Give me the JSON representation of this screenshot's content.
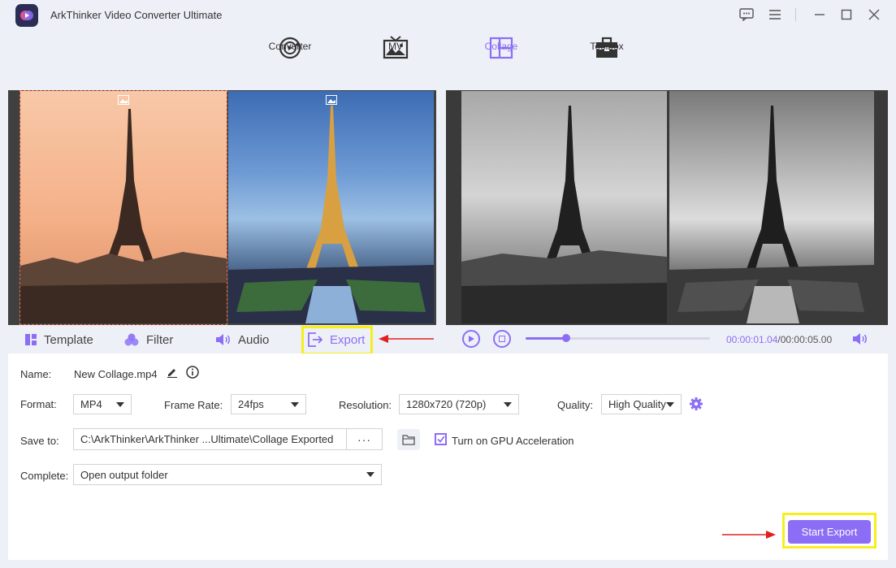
{
  "app": {
    "title": "ArkThinker Video Converter Ultimate"
  },
  "nav": {
    "items": [
      {
        "label": "Converter",
        "icon": "converter-icon"
      },
      {
        "label": "MV",
        "icon": "mv-icon"
      },
      {
        "label": "Collage",
        "icon": "collage-icon",
        "active": true
      },
      {
        "label": "Toolbox",
        "icon": "toolbox-icon"
      }
    ]
  },
  "tabs": {
    "template": "Template",
    "filter": "Filter",
    "audio": "Audio",
    "export": "Export"
  },
  "player": {
    "current_time": "00:00:01.04",
    "separator": "/",
    "total_time": "00:00:05.00",
    "progress": 0.22
  },
  "settings": {
    "name_label": "Name:",
    "name_value": "New Collage.mp4",
    "format_label": "Format:",
    "format_value": "MP4",
    "framerate_label": "Frame Rate:",
    "framerate_value": "24fps",
    "resolution_label": "Resolution:",
    "resolution_value": "1280x720 (720p)",
    "quality_label": "Quality:",
    "quality_value": "High Quality",
    "saveto_label": "Save to:",
    "saveto_value": "C:\\ArkThinker\\ArkThinker ...Ultimate\\Collage Exported",
    "dots": "···",
    "gpu_label": "Turn on GPU Acceleration",
    "gpu_checked": true,
    "complete_label": "Complete:",
    "complete_value": "Open output folder"
  },
  "actions": {
    "start_export": "Start Export"
  },
  "colors": {
    "accent": "#8b6ef5",
    "highlight": "#f7ef1c",
    "arrow": "#e02020"
  }
}
